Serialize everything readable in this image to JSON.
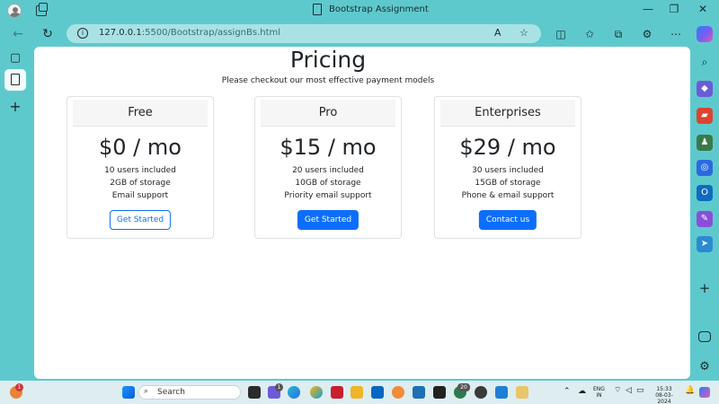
{
  "window": {
    "title": "Bootstrap Assignment",
    "minimize_glyph": "—",
    "maximize_glyph": "❐",
    "close_glyph": "✕"
  },
  "addressbar": {
    "url_host": "127.0.0.1",
    "url_rest": ":5500/Bootstrap/assignBs.html",
    "info_glyph": "i",
    "read_aloud_glyph": "A",
    "favorite_glyph": "☆"
  },
  "nav": {
    "back_glyph": "←",
    "refresh_glyph": "↻"
  },
  "toolbar": {
    "split_glyph": "◫",
    "favorites_glyph": "✩",
    "collections_glyph": "⧉",
    "extensions_glyph": "⚙",
    "more_glyph": "⋯"
  },
  "left_sidebar": {
    "tabs_glyph": "▢",
    "add_glyph": "+"
  },
  "right_sidebar": {
    "add_glyph": "+",
    "settings_glyph": "⚙"
  },
  "page": {
    "title": "Pricing",
    "subtitle": "Please checkout our most effective payment models",
    "plans": [
      {
        "name": "Free",
        "price": "$0 / mo",
        "features": [
          "10 users included",
          "2GB of storage",
          "Email support"
        ],
        "button": "Get Started"
      },
      {
        "name": "Pro",
        "price": "$15 / mo",
        "features": [
          "20 users included",
          "10GB of storage",
          "Priority email support"
        ],
        "button": "Get Started"
      },
      {
        "name": "Enterprises",
        "price": "$29 / mo",
        "features": [
          "30 users included",
          "15GB of storage",
          "Phone & email support"
        ],
        "button": "Contact us"
      }
    ]
  },
  "taskbar": {
    "search_label": "Search",
    "notification_badge": "1",
    "copilot_badge": "1",
    "chat_badge": "20",
    "lang_line1": "ENG",
    "lang_line2": "IN",
    "time": "15:33",
    "date": "08-03-2024"
  },
  "colors": {
    "accent": "#0d6efd",
    "frame": "#5ec9cd",
    "addressbar": "#a9e2e4"
  }
}
